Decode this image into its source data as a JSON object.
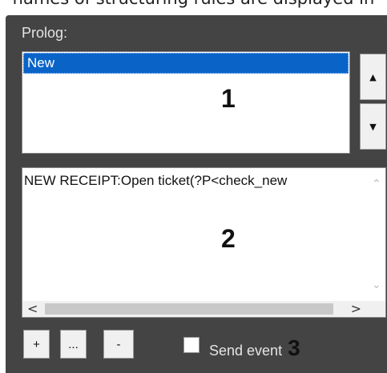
{
  "caption": "names of structuring rules are displayed in",
  "prolog": {
    "label": "Prolog:",
    "items": [
      "New"
    ],
    "marker": "1"
  },
  "list_controls": {
    "up_icon": "▲",
    "down_icon": "▼"
  },
  "editor": {
    "text": "NEW RECEIPT:Open ticket(?P<check_new",
    "marker": "2"
  },
  "toolbar": {
    "add_label": "+",
    "edit_label": "...",
    "remove_label": "-"
  },
  "send_event": {
    "label": "Send event",
    "checked": false,
    "marker": "3"
  }
}
